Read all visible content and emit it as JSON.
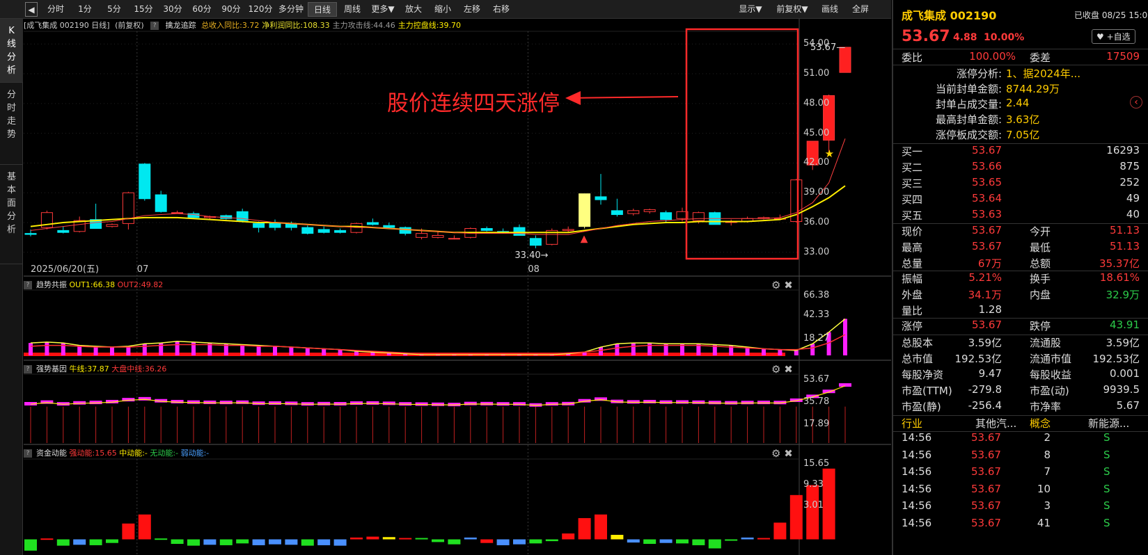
{
  "toolbar": {
    "items": [
      "分时",
      "1分",
      "5分",
      "15分",
      "30分",
      "60分",
      "90分",
      "120分",
      "多分钟",
      "日线",
      "周线",
      "更多▼",
      "放大",
      "缩小",
      "左移",
      "右移"
    ],
    "active": "日线",
    "right": [
      "显示▼",
      "前复权▼",
      "画线",
      "全屏"
    ]
  },
  "left_tabs": [
    "K线分析",
    "分时走势",
    "基本面分析"
  ],
  "header": {
    "stock": "[成飞集成 002190 日线]",
    "adj": "(前复权)",
    "indicator": "擒龙追踪",
    "items": [
      {
        "t": "总收入同比:3.72",
        "c": "#e8b020"
      },
      {
        "t": "净利润同比:108.33",
        "c": "#e8e030"
      },
      {
        "t": "主力攻击线:44.46",
        "c": "#9a9a9a"
      },
      {
        "t": "主力控盘线:39.70",
        "c": "#ffee00"
      }
    ]
  },
  "annotation": {
    "text": "股价连续四天涨停"
  },
  "chart_data": {
    "type": "candlestick",
    "start_date": "2025/06/20(五)",
    "month_labels": [
      {
        "i": 7,
        "t": "07"
      },
      {
        "i": 31,
        "t": "08"
      }
    ],
    "ylim": [
      32,
      55
    ],
    "yticks": [
      33,
      36,
      39,
      42,
      45,
      48,
      51,
      54
    ],
    "ohlc": [
      [
        34.9,
        35.3,
        34.6,
        34.8
      ],
      [
        35.5,
        37.2,
        35.3,
        37.0
      ],
      [
        35.2,
        35.6,
        34.9,
        35.0
      ],
      [
        35.1,
        36.6,
        35.0,
        36.2
      ],
      [
        36.3,
        37.9,
        35.8,
        35.4
      ],
      [
        35.6,
        35.9,
        35.5,
        35.8
      ],
      [
        35.9,
        39.1,
        35.3,
        39.0
      ],
      [
        41.9,
        42.0,
        38.2,
        38.4
      ],
      [
        38.8,
        39.2,
        37.0,
        37.1
      ],
      [
        37.0,
        37.2,
        36.9,
        37.0
      ],
      [
        36.9,
        37.1,
        36.4,
        36.5
      ],
      [
        36.5,
        36.7,
        36.3,
        36.6
      ],
      [
        36.7,
        36.8,
        36.3,
        36.4
      ],
      [
        37.1,
        37.4,
        36.0,
        36.2
      ],
      [
        35.9,
        36.1,
        35.0,
        35.5
      ],
      [
        35.9,
        36.3,
        35.2,
        35.5
      ],
      [
        35.9,
        36.1,
        35.2,
        35.5
      ],
      [
        35.5,
        35.7,
        34.8,
        34.9
      ],
      [
        35.3,
        35.6,
        34.9,
        35.0
      ],
      [
        35.2,
        35.4,
        34.9,
        35.0
      ],
      [
        35.0,
        36.0,
        34.9,
        35.9
      ],
      [
        36.0,
        36.4,
        35.7,
        35.8
      ],
      [
        35.7,
        36.0,
        35.5,
        35.5
      ],
      [
        35.5,
        35.6,
        34.7,
        34.9
      ],
      [
        34.5,
        35.4,
        34.3,
        34.9
      ],
      [
        34.5,
        35.1,
        34.4,
        34.7
      ],
      [
        34.4,
        34.7,
        34.3,
        34.4
      ],
      [
        34.5,
        35.5,
        34.4,
        35.4
      ],
      [
        35.4,
        35.6,
        35.1,
        35.2
      ],
      [
        35.1,
        35.4,
        34.9,
        35.0
      ],
      [
        35.5,
        35.8,
        35.0,
        34.7
      ],
      [
        34.4,
        34.7,
        33.4,
        33.7
      ],
      [
        33.8,
        35.4,
        33.7,
        35.2
      ],
      [
        35.2,
        35.6,
        35.0,
        35.3
      ],
      [
        35.6,
        38.9,
        35.4,
        38.9
      ],
      [
        38.6,
        40.9,
        37.8,
        38.3
      ],
      [
        37.2,
        38.4,
        36.6,
        36.8
      ],
      [
        36.9,
        37.4,
        36.7,
        37.2
      ],
      [
        37.1,
        37.4,
        36.9,
        37.3
      ],
      [
        37.0,
        37.2,
        36.0,
        36.3
      ],
      [
        36.4,
        37.5,
        36.1,
        37.1
      ],
      [
        36.2,
        37.1,
        35.9,
        37.0
      ],
      [
        37.0,
        37.1,
        35.8,
        35.8
      ],
      [
        36.0,
        36.3,
        35.7,
        36.1
      ],
      [
        36.1,
        36.6,
        36.0,
        36.4
      ],
      [
        36.4,
        36.6,
        36.3,
        36.5
      ],
      [
        36.4,
        36.8,
        36.3,
        36.4
      ],
      [
        36.1,
        40.4,
        36.0,
        40.3
      ],
      [
        41.8,
        44.2,
        41.3,
        44.2
      ],
      [
        44.3,
        48.9,
        43.0,
        48.8
      ],
      [
        51.13,
        53.67,
        51.13,
        53.67
      ]
    ],
    "ma_attack": [
      35.2,
      35.4,
      35.6,
      35.8,
      36.0,
      36.1,
      36.4,
      36.7,
      36.8,
      36.9,
      36.8,
      36.6,
      36.5,
      36.4,
      36.2,
      36.0,
      35.9,
      35.8,
      35.7,
      35.6,
      35.5,
      35.5,
      35.4,
      35.3,
      35.2,
      35.1,
      35.0,
      34.9,
      34.9,
      34.9,
      34.9,
      34.8,
      34.8,
      34.8,
      35.1,
      35.4,
      35.7,
      35.9,
      36.1,
      36.2,
      36.3,
      36.4,
      36.4,
      36.4,
      36.4,
      36.4,
      36.5,
      37.0,
      38.0,
      40.0,
      44.46
    ],
    "ma_control": [
      35.6,
      35.8,
      36.0,
      36.1,
      36.2,
      36.3,
      36.4,
      36.5,
      36.5,
      36.5,
      36.4,
      36.3,
      36.2,
      36.1,
      36.0,
      36.0,
      35.9,
      35.8,
      35.7,
      35.6,
      35.6,
      35.5,
      35.4,
      35.3,
      35.2,
      35.1,
      35.0,
      35.0,
      35.0,
      35.0,
      35.0,
      35.0,
      35.0,
      35.0,
      35.2,
      35.4,
      35.6,
      35.8,
      35.9,
      36.0,
      36.0,
      36.1,
      36.1,
      36.1,
      36.1,
      36.2,
      36.3,
      36.8,
      37.6,
      38.5,
      39.7
    ],
    "low_label": {
      "i": 31,
      "t": "33.40"
    },
    "high_label": {
      "i": 50,
      "t": "53.67"
    }
  },
  "panel2": {
    "title": "趋势共振",
    "l1": "OUT1:66.38",
    "l2": "OUT2:49.82",
    "yticks": [
      "66.38",
      "42.33",
      "18.27"
    ],
    "ylim": [
      0,
      72
    ],
    "out1": [
      15,
      16,
      15,
      12,
      11,
      10,
      11,
      14,
      15,
      17,
      16,
      15,
      14,
      13,
      12,
      11,
      10,
      9,
      8,
      7,
      5,
      4,
      3,
      2,
      1,
      1,
      1,
      1,
      1,
      1,
      1,
      1,
      1,
      2,
      4,
      10,
      14,
      15,
      15,
      14,
      14,
      14,
      13,
      12,
      10,
      8,
      7,
      6,
      14,
      28,
      44,
      66.38
    ],
    "out2": [
      11,
      12,
      12,
      11,
      10,
      10,
      10,
      11,
      12,
      13,
      13,
      13,
      12,
      12,
      11,
      11,
      10,
      9,
      8,
      7,
      6,
      5,
      4,
      3,
      2,
      2,
      2,
      2,
      2,
      2,
      2,
      2,
      2,
      3,
      4,
      6,
      9,
      11,
      12,
      12,
      12,
      12,
      11,
      10,
      9,
      8,
      7,
      7,
      9,
      15,
      25,
      38,
      49.82
    ]
  },
  "panel3": {
    "title": "强势基因",
    "l1": "牛线:37.87",
    "l2": "大盘中线:36.26",
    "yticks": [
      "53.67",
      "35.78",
      "17.89"
    ],
    "ylim": [
      0,
      58
    ],
    "vals": [
      35.3,
      36.8,
      35.2,
      36.1,
      36.5,
      37.2,
      39.0,
      39.8,
      38.0,
      37.2,
      36.8,
      36.6,
      36.5,
      36.7,
      35.8,
      35.9,
      35.7,
      35.2,
      35.4,
      35.3,
      35.9,
      36.0,
      35.7,
      35.2,
      35.0,
      34.8,
      34.6,
      35.5,
      35.4,
      35.2,
      35.2,
      34.2,
      35.2,
      35.4,
      38.0,
      39.5,
      37.4,
      37.0,
      37.2,
      36.8,
      36.9,
      36.7,
      36.4,
      36.2,
      36.4,
      36.5,
      36.4,
      38.5,
      42.0,
      46.5,
      52.3
    ],
    "base": 33.0
  },
  "panel4": {
    "title": "资金动能",
    "l1": "强动能:15.65",
    "l2": "中动能:-",
    "l3": "无动能:-",
    "l4": "弱动能:-",
    "yticks": [
      "15.65",
      "9.33",
      "3.01"
    ],
    "ylim": [
      -3,
      17
    ],
    "vals": [
      -2.5,
      0.2,
      -1.4,
      -1.2,
      -1.3,
      -0.8,
      3.5,
      5.5,
      0.2,
      -1.0,
      -1.4,
      -1.2,
      -1.3,
      -0.9,
      -1.3,
      -1.1,
      -1.2,
      -1.4,
      -1.3,
      -1.4,
      0.4,
      0.6,
      0.5,
      0.3,
      0.3,
      -0.6,
      -1.1,
      0.4,
      -0.8,
      -1.3,
      -1.1,
      -0.9,
      -0.4,
      1.3,
      4.7,
      5.5,
      1.0,
      -0.7,
      -1.0,
      -0.8,
      -0.9,
      -1.3,
      -2.0,
      -0.3,
      0.4,
      0.3,
      3.7,
      9.8,
      12.0,
      15.65
    ],
    "colors": [
      "grn",
      "red",
      "grn",
      "blu",
      "grn",
      "grn",
      "red",
      "red",
      "grn",
      "grn",
      "grn",
      "blu",
      "grn",
      "grn",
      "blu",
      "blu",
      "blu",
      "grn",
      "blu",
      "blu",
      "red",
      "red",
      "yel",
      "red",
      "grn",
      "grn",
      "grn",
      "blu",
      "red",
      "blu",
      "blu",
      "grn",
      "grn",
      "red",
      "red",
      "red",
      "yel",
      "blu",
      "grn",
      "blu",
      "grn",
      "grn",
      "grn",
      "grn",
      "blu",
      "red",
      "red",
      "red",
      "red",
      "red"
    ]
  },
  "right": {
    "name": "成飞集成 002190",
    "status": "已收盘 08/25 15:00",
    "price": "53.67",
    "chg": "4.88",
    "pct": "10.00%",
    "fav": "+自选",
    "weibi_l": "委比",
    "weibi_v": "100.00%",
    "weicha_l": "委差",
    "weicha_v": "17509",
    "zt_rows": [
      [
        "涨停分析:",
        "1、据2024年..."
      ],
      [
        "当前封单金额:",
        "8744.29万"
      ],
      [
        "封单占成交量:",
        "2.44"
      ],
      [
        "最高封单金额:",
        "3.63亿"
      ],
      [
        "涨停板成交额:",
        "7.05亿"
      ]
    ],
    "buys": [
      [
        "买一",
        "53.67",
        "16293"
      ],
      [
        "买二",
        "53.66",
        "875"
      ],
      [
        "买三",
        "53.65",
        "252"
      ],
      [
        "买四",
        "53.64",
        "49"
      ],
      [
        "买五",
        "53.63",
        "40"
      ]
    ],
    "q1": [
      [
        "现价",
        "53.67",
        "今开",
        "51.13"
      ],
      [
        "最高",
        "53.67",
        "最低",
        "51.13"
      ],
      [
        "总量",
        "67万",
        "总额",
        "35.37亿"
      ]
    ],
    "q2": [
      [
        "振幅",
        "5.21%",
        "换手",
        "18.61%"
      ],
      [
        "外盘",
        "34.1万",
        "内盘",
        "32.9万"
      ],
      [
        "量比",
        "1.28",
        "",
        ""
      ]
    ],
    "q3": [
      [
        "涨停",
        "53.67",
        "跌停",
        "43.91"
      ]
    ],
    "q4": [
      [
        "总股本",
        "3.59亿",
        "流通股",
        "3.59亿"
      ],
      [
        "总市值",
        "192.53亿",
        "流通市值",
        "192.53亿"
      ],
      [
        "每股净资",
        "9.47",
        "每股收益",
        "0.001"
      ],
      [
        "市盈(TTM)",
        "-279.8",
        "市盈(动)",
        "9939.5"
      ],
      [
        "市盈(静)",
        "-256.4",
        "市净率",
        "5.67"
      ]
    ],
    "ind": [
      "行业",
      "其他汽...",
      "概念",
      "新能源..."
    ],
    "ticks": [
      [
        "14:56",
        "53.67",
        "2",
        "S"
      ],
      [
        "14:56",
        "53.67",
        "8",
        "S"
      ],
      [
        "14:56",
        "53.67",
        "7",
        "S"
      ],
      [
        "14:56",
        "53.67",
        "10",
        "S"
      ],
      [
        "14:56",
        "53.67",
        "3",
        "S"
      ],
      [
        "14:56",
        "53.67",
        "41",
        "S"
      ]
    ]
  },
  "colors": {
    "up": "#ff3a3a",
    "down": "#00e8f0",
    "yellow": "#ffee00",
    "magenta": "#ff20ff"
  }
}
